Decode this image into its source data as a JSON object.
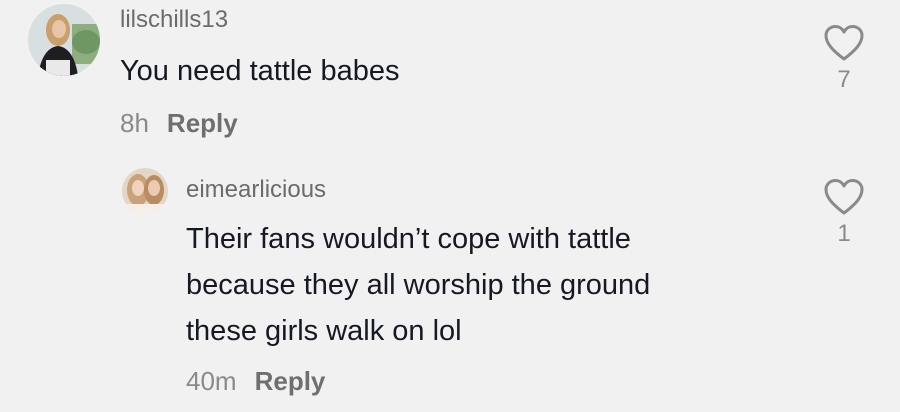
{
  "comments": [
    {
      "username": "lilschills13",
      "text_lines": [
        "You need tattle babes"
      ],
      "time": "8h",
      "reply_label": "Reply",
      "like_count": "7",
      "avatar_icon": "profile-photo"
    },
    {
      "username": "eimearlicious",
      "text_lines": [
        "Their fans wouldn’t cope with tattle",
        "because they all worship the ground",
        "these girls walk on lol"
      ],
      "time": "40m",
      "reply_label": "Reply",
      "like_count": "1",
      "avatar_icon": "profile-photo"
    }
  ],
  "icons": {
    "like": "heart-outline-icon"
  },
  "colors": {
    "background": "#f1f1f1",
    "text": "#161823",
    "muted": "#8a8a8a",
    "reply": "#6f6f6f"
  }
}
